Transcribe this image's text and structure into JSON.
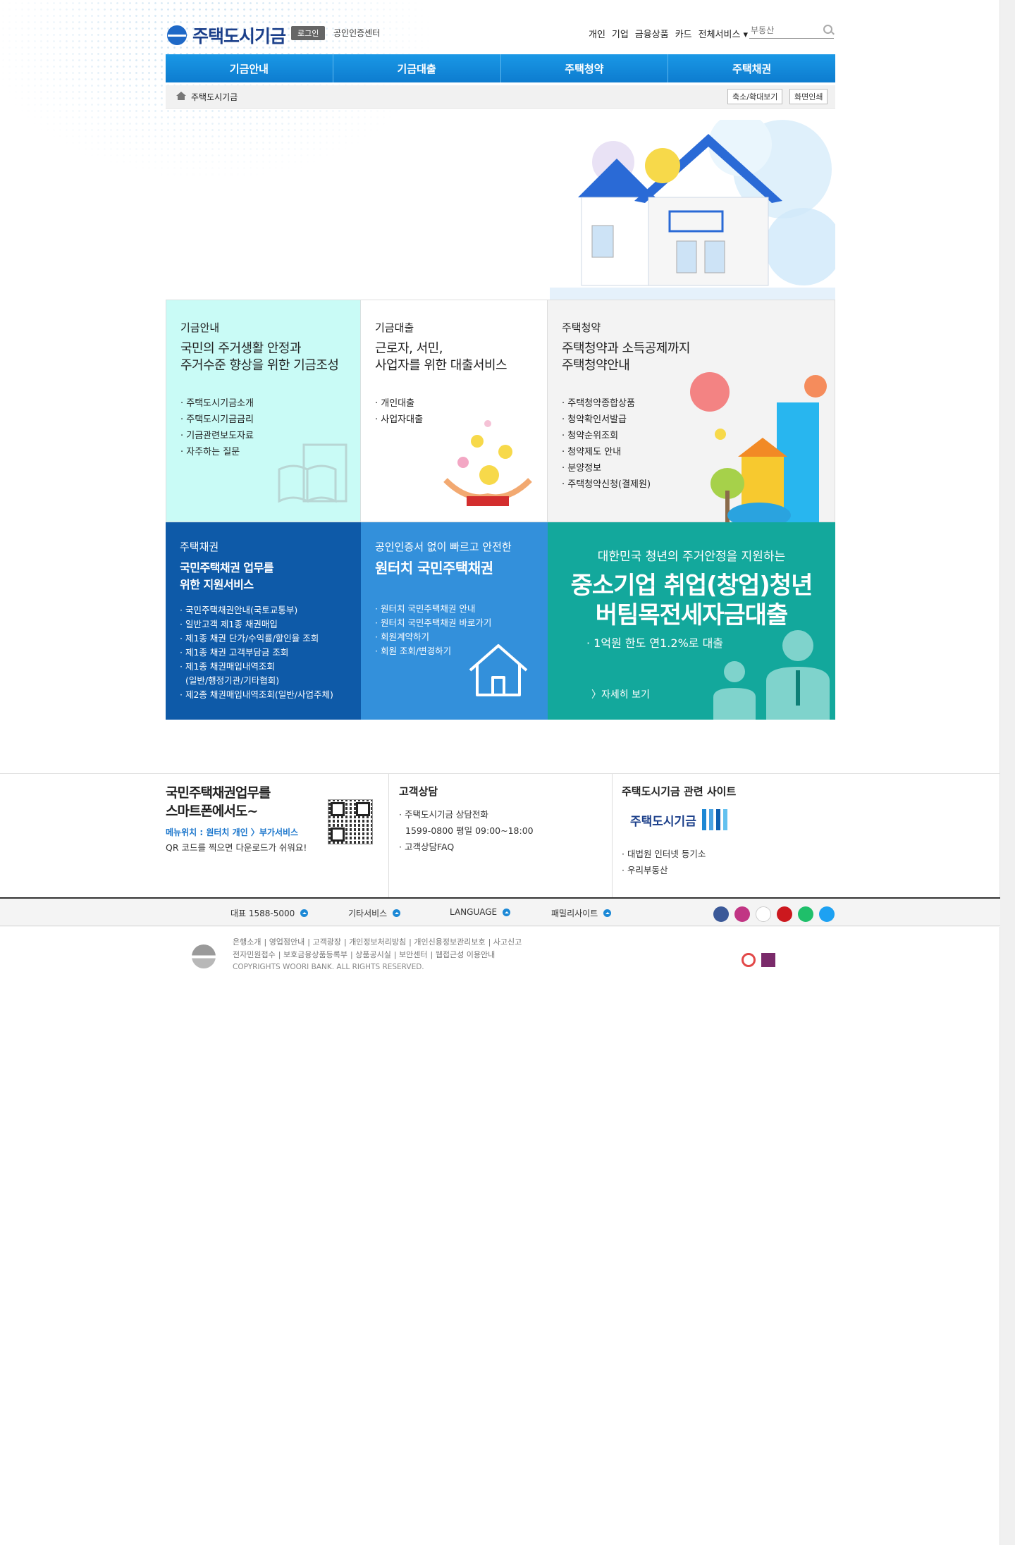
{
  "header": {
    "logo_text": "주택도시기금",
    "login_label": "로그인",
    "cert_center_label": "공인인증센터",
    "topnav": [
      "개인",
      "기업",
      "금융상품",
      "카드",
      "전체서비스 ▾"
    ],
    "search_placeholder": "부동산"
  },
  "gnb": [
    "기금안내",
    "기금대출",
    "주택청약",
    "주택채권"
  ],
  "location": {
    "crumb": "주택도시기금",
    "zoom_label": "축소/확대보기",
    "print_label": "화면인쇄"
  },
  "cards": {
    "fund_info": {
      "title": "기금안내",
      "subtitle_1": "국민의 주거생활 안정과",
      "subtitle_2": "주거수준 향상을 위한 기금조성",
      "items": [
        "주택도시기금소개",
        "주택도시기금금리",
        "기금관련보도자료",
        "자주하는 질문"
      ]
    },
    "fund_loan": {
      "title": "기금대출",
      "subtitle_1": "근로자, 서민,",
      "subtitle_2": "사업자를 위한 대출서비스",
      "items": [
        "개인대출",
        "사업자대출"
      ]
    },
    "subscription": {
      "title": "주택청약",
      "subtitle_1": "주택청약과 소득공제까지",
      "subtitle_2": "주택청약안내",
      "items": [
        "주택청약종합상품",
        "청약확인서발급",
        "청약순위조회",
        "청약제도 안내",
        "분양정보",
        "주택청약신청(결제원)"
      ]
    },
    "housing_bond": {
      "title": "주택채권",
      "subtitle_1": "국민주택채권 업무를",
      "subtitle_2": "위한 지원서비스",
      "items": [
        "국민주택채권안내(국토교통부)",
        "일반고객 제1종 채권매입",
        "제1종 채권 단가/수익률/할인율 조회",
        "제1종 채권 고객부담금 조회",
        "제1종 채권매입내역조회",
        "(일반/행정기관/기타협회)",
        "제2종 채권매입내역조회(일반/사업주체)"
      ]
    },
    "one_touch": {
      "title": "공인인증서 없이 빠르고 안전한",
      "subtitle": "원터치 국민주택채권",
      "items": [
        "원터치 국민주택채권 안내",
        "원터치 국민주택채권 바로가기",
        "회원계약하기",
        "회원 조회/변경하기"
      ]
    },
    "promo": {
      "line1": "대한민국 청년의 주거안정을 지원하는",
      "line2": "중소기업 취업(창업)청년",
      "line3": "버팀목전세자금대출",
      "line4": "· 1억원 한도 연1.2%로 대출",
      "more": "〉자세히 보기"
    }
  },
  "footer": {
    "qr": {
      "title_1": "국민주택채권업무를",
      "title_2": "스마트폰에서도~",
      "menu": "메뉴위치 : 원터치 개인 〉부가서비스",
      "desc": "QR 코드를 찍으면 다운로드가 쉬워요!"
    },
    "consult": {
      "title": "고객상담",
      "line1": "주택도시기금 상담전화",
      "phone": "1599-0800 평일 09:00~18:00",
      "line3": "고객상담FAQ"
    },
    "related": {
      "title": "주택도시기금 관련 사이트",
      "logo_text": "주택도시기금",
      "items": [
        "대법원 인터넷 등기소",
        "우리부동산"
      ]
    },
    "bar": {
      "rep": "대표 1588-5000",
      "other": "기타서비스",
      "lang": "LANGUAGE",
      "family": "패밀리사이트"
    },
    "links_row1": [
      "은행소개",
      "영업점안내",
      "고객광장",
      "개인정보처리방침",
      "개인신용정보관리보호",
      "사고신고"
    ],
    "links_row2": [
      "전자민원접수",
      "보호금융상품등록부",
      "상품공시실",
      "보안센터",
      "웹접근성 이용안내"
    ],
    "copyright": "COPYRIGHTS WOORI BANK. ALL RIGHTS RESERVED."
  },
  "colors": {
    "brand_blue": "#1b3f8a",
    "gnb_blue": "#1a98e6",
    "mint": "#c9fbf6",
    "bond_blue": "#0e5aa8",
    "onetouch_blue": "#3390db",
    "promo_teal": "#13a89c"
  }
}
